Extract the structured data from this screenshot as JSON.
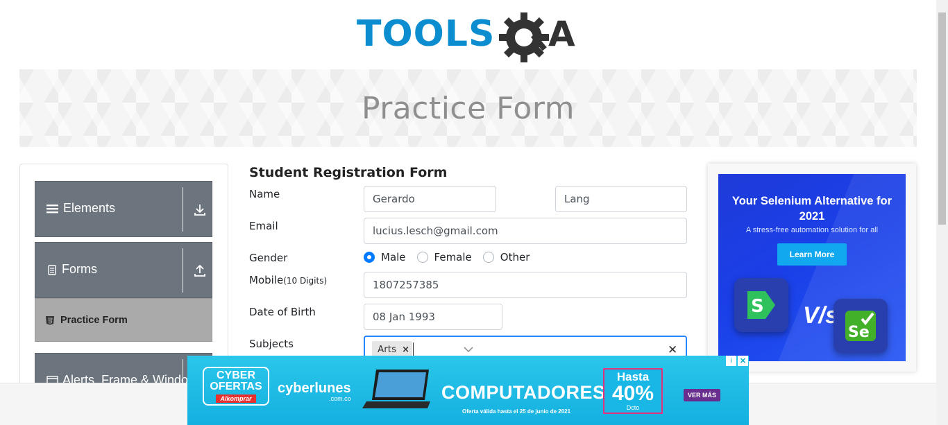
{
  "brand": {
    "logo_text": "TOOLSQA"
  },
  "banner": {
    "title": "Practice Form"
  },
  "leftnav": {
    "groups": [
      {
        "label": "Elements",
        "icon": "menu-icon",
        "toggle": "download-icon"
      },
      {
        "label": "Forms",
        "icon": "document-icon",
        "toggle": "upload-icon"
      },
      {
        "label": "Alerts, Frame & Windows",
        "icon": "window-icon"
      }
    ],
    "active_item": {
      "label": "Practice Form",
      "icon": "html5-icon"
    }
  },
  "form": {
    "title": "Student Registration Form",
    "name_label": "Name",
    "first_name": "Gerardo",
    "last_name": "Lang",
    "email_label": "Email",
    "email": "lucius.lesch@gmail.com",
    "gender_label": "Gender",
    "gender_options": [
      "Male",
      "Female",
      "Other"
    ],
    "gender_selected": "Male",
    "mobile_label": "Mobile",
    "mobile_hint": "(10 Digits)",
    "mobile": "1807257385",
    "dob_label": "Date of Birth",
    "dob": "08 Jan 1993",
    "subjects_label": "Subjects",
    "subjects": [
      "Arts"
    ]
  },
  "side_ad": {
    "headline": "Your Selenium Alternative for 2021",
    "subline": "A stress-free automation solution for all",
    "cta": "Learn More",
    "vs": "V/s"
  },
  "bottom_ad": {
    "badge_line1": "CYBER",
    "badge_line2": "OFERTAS",
    "badge_store": "Alkomprar",
    "cyberlunes": "cyberlunes",
    "cyberlunes_domain": ".com.co",
    "headline": "COMPUTADORES",
    "hasta_label": "Hasta",
    "discount": "40%",
    "discount_suffix": "Dcto",
    "cta": "VER MÁS",
    "fineprint": "Oferta válida hasta el 25 de junio de 2021"
  },
  "colors": {
    "nav_gray": "#6c757d",
    "active_item_bg": "#aaaaaa",
    "radio_blue": "#007bff",
    "focus_blue": "#2684ff",
    "logo_blue": "#0b8dd0",
    "logo_dark": "#333333"
  }
}
